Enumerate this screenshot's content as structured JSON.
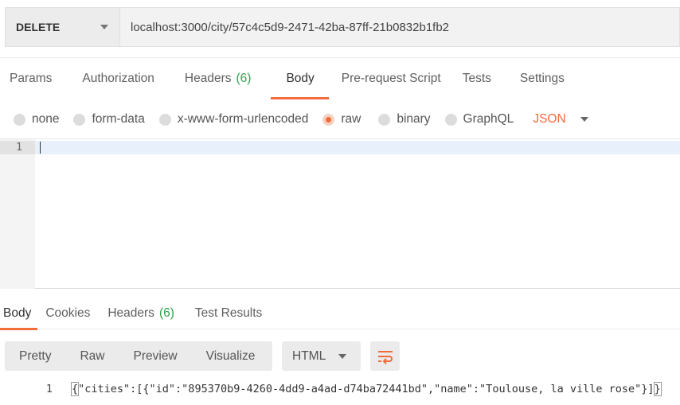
{
  "request": {
    "method": "DELETE",
    "url": "localhost:3000/city/57c4c5d9-2471-42ba-87ff-21b0832b1fb2"
  },
  "request_tabs": [
    {
      "label": "Params"
    },
    {
      "label": "Authorization"
    },
    {
      "label": "Headers",
      "count": "(6)"
    },
    {
      "label": "Body",
      "active": true
    },
    {
      "label": "Pre-request Script"
    },
    {
      "label": "Tests"
    },
    {
      "label": "Settings"
    }
  ],
  "body_types": {
    "options": [
      "none",
      "form-data",
      "x-www-form-urlencoded",
      "raw",
      "binary",
      "GraphQL"
    ],
    "selected": "raw",
    "format": "JSON"
  },
  "editor": {
    "line_number": "1",
    "content": ""
  },
  "response_tabs": [
    {
      "label": "Body",
      "active": true
    },
    {
      "label": "Cookies"
    },
    {
      "label": "Headers",
      "count": "(6)"
    },
    {
      "label": "Test Results"
    }
  ],
  "response_toolbar": {
    "views": [
      "Pretty",
      "Raw",
      "Preview",
      "Visualize"
    ],
    "format": "HTML",
    "wrap_icon": "wrap-lines-icon"
  },
  "response_body": {
    "line_number": "1",
    "open_brace": "{",
    "content": "\"cities\":[{\"id\":\"895370b9-4260-4dd9-a4ad-d74ba72441bd\",\"name\":\"Toulouse, la ville rose\"}]",
    "close_brace": "}"
  },
  "colors": {
    "accent": "#f26b3a",
    "count_green": "#2da44e"
  }
}
